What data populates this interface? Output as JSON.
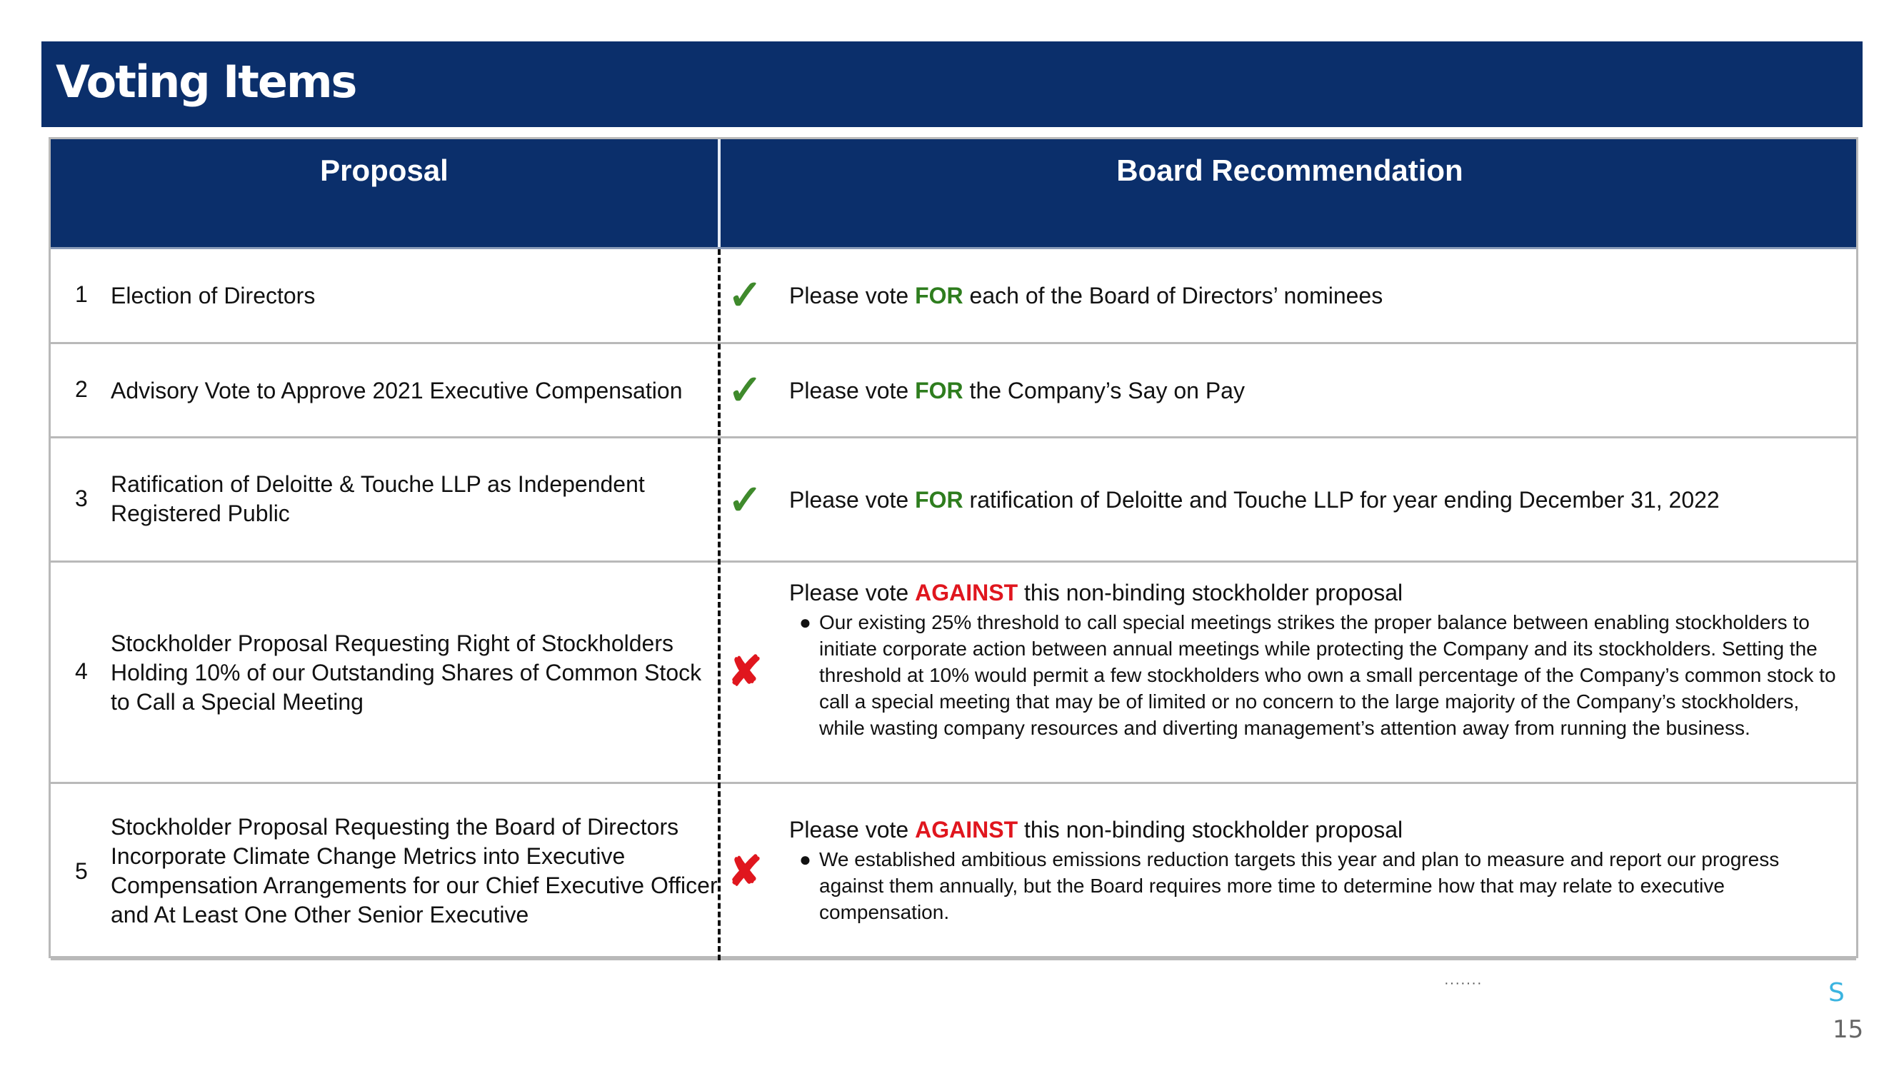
{
  "page": {
    "title": "Voting Items",
    "number": "15",
    "logo_text": "S"
  },
  "colors": {
    "navy": "#0b2f6b",
    "for_green": "#2e7d1e",
    "against_red": "#e0161e",
    "check_green": "#3f8a2c"
  },
  "table": {
    "headers": {
      "proposal": "Proposal",
      "recommendation": "Board Recommendation"
    },
    "rows": [
      {
        "num": "1",
        "proposal": "Election of Directors",
        "icon": "check-icon",
        "mark": "✓",
        "rec_prefix": "Please vote ",
        "rec_keyword": "FOR",
        "rec_suffix": " each of the Board of Directors’ nominees",
        "bullets": []
      },
      {
        "num": "2",
        "proposal": "Advisory Vote to Approve 2021 Executive Compensation",
        "icon": "check-icon",
        "mark": "✓",
        "rec_prefix": "Please vote ",
        "rec_keyword": "FOR",
        "rec_suffix": " the Company’s Say on Pay",
        "bullets": []
      },
      {
        "num": "3",
        "proposal": "Ratification of Deloitte & Touche LLP as Independent Registered Public",
        "icon": "check-icon",
        "mark": "✓",
        "rec_prefix": "Please vote ",
        "rec_keyword": "FOR",
        "rec_suffix": " ratification of Deloitte and Touche LLP for year ending December 31, 2022",
        "bullets": []
      },
      {
        "num": "4",
        "proposal": "Stockholder Proposal Requesting Right of Stockholders Holding 10% of our Outstanding Shares of Common Stock to Call a Special Meeting",
        "icon": "cross-icon",
        "mark": "✘",
        "rec_prefix": "Please vote ",
        "rec_keyword": "AGAINST",
        "rec_suffix": " this non-binding stockholder proposal",
        "bullets": [
          "Our existing 25% threshold to call special meetings strikes the proper balance between enabling stockholders to initiate corporate action between annual meetings while protecting the Company and its stockholders. Setting the threshold at 10% would permit a few stockholders who own a small percentage of the Company’s common stock to call a special meeting that may be of limited or no concern to the large majority of the Company’s stockholders, while wasting company resources and diverting management’s attention away from running the business."
        ]
      },
      {
        "num": "5",
        "proposal": "Stockholder Proposal Requesting the Board of Directors Incorporate Climate Change Metrics into Executive Compensation Arrangements for our Chief Executive Officer and At Least One Other Senior Executive",
        "icon": "cross-icon",
        "mark": "✘",
        "rec_prefix": "Please vote ",
        "rec_keyword": "AGAINST",
        "rec_suffix": " this non-binding stockholder proposal",
        "bullets": [
          "We established ambitious emissions reduction targets this year and plan to measure and report our progress against them annually, but the Board requires more time to determine how that may relate to executive compensation."
        ]
      }
    ]
  }
}
